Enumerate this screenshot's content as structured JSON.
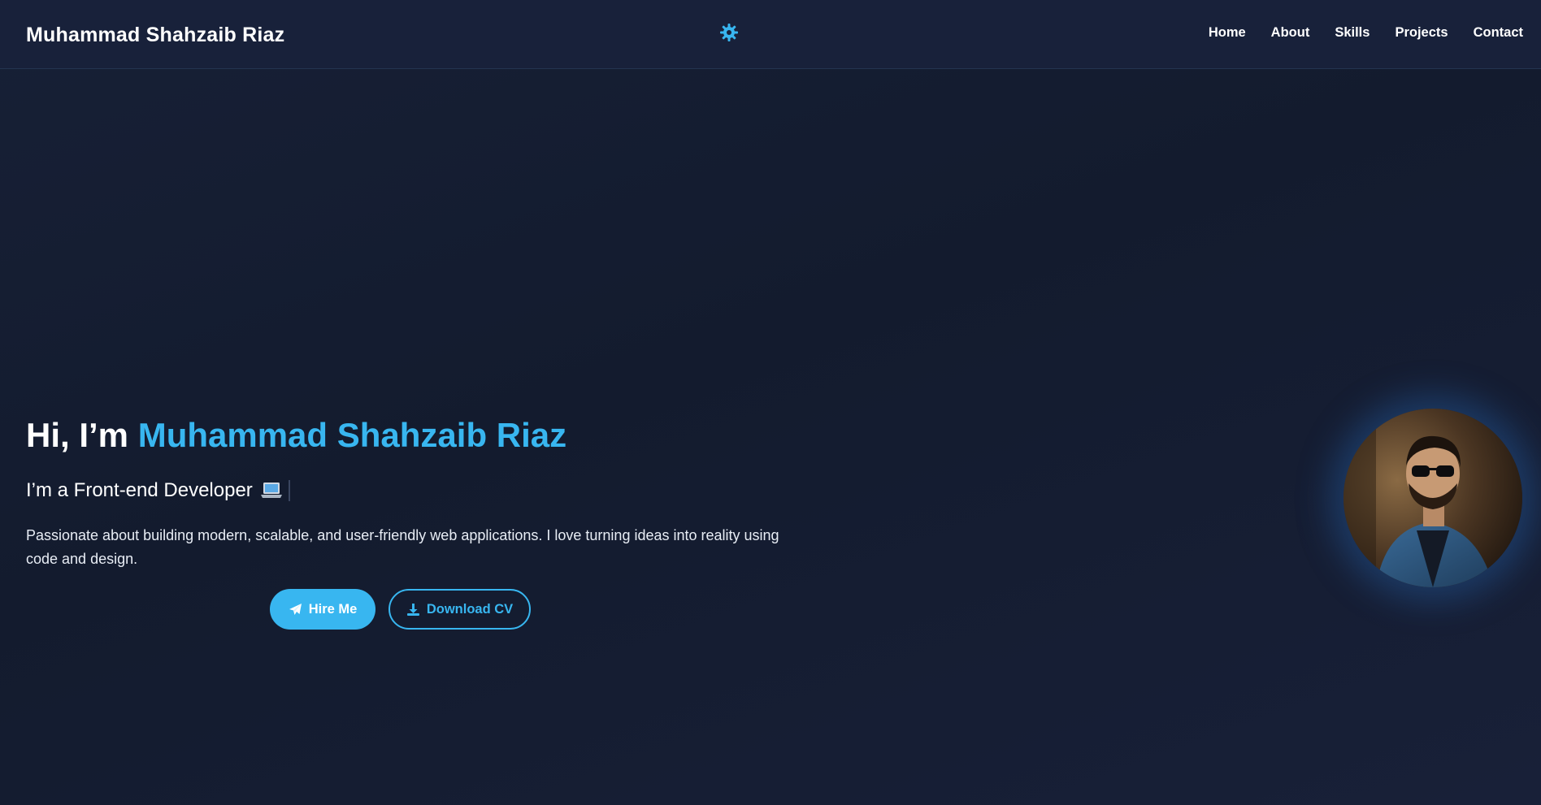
{
  "navbar": {
    "brand": "Muhammad Shahzaib Riaz",
    "theme_toggle_icon": "gear-icon",
    "links": [
      "Home",
      "About",
      "Skills",
      "Projects",
      "Contact"
    ]
  },
  "hero": {
    "greeting": "Hi, I’m",
    "name": "Muhammad Shahzaib Riaz",
    "subtitle": "I’m a Front-end Developer",
    "subtitle_icon": "laptop-icon",
    "description": "Passionate about building modern, scalable, and user-friendly web applications. I love turning ideas into reality using code and design.",
    "hire_button": "Hire Me",
    "hire_icon": "paper-plane-icon",
    "cv_button": "Download CV",
    "cv_icon": "download-icon"
  },
  "colors": {
    "accent": "#38b6f0",
    "background": "#141c30",
    "navbar": "#18213a"
  }
}
